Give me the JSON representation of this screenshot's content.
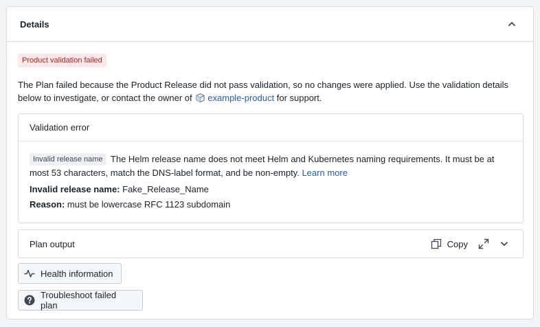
{
  "details": {
    "title": "Details",
    "badge": "Product validation failed",
    "message_before": "The Plan failed because the Product Release did not pass validation, so no changes were applied. Use the validation details below to investigate, or contact the owner of",
    "product_link": "example-product",
    "message_after": "for support."
  },
  "validation": {
    "title": "Validation error",
    "tag": "Invalid release name",
    "description": "The Helm release name does not meet Helm and Kubernetes naming requirements. It must be at most 53 characters, match the DNS-label format, and be non-empty.",
    "learn_more": "Learn more",
    "name_label": "Invalid release name:",
    "name_value": "Fake_Release_Name",
    "reason_label": "Reason:",
    "reason_value": "must be lowercase RFC 1123 subdomain"
  },
  "plan_output": {
    "title": "Plan output",
    "copy_label": "Copy"
  },
  "buttons": {
    "health": "Health information",
    "troubleshoot": "Troubleshoot failed plan"
  },
  "icons": {
    "collapse": "chevron-up-icon",
    "product": "cube-icon",
    "copy": "duplicate-icon",
    "expand": "maximize-icon",
    "expand_section": "chevron-down-icon",
    "health": "pulse-icon",
    "help": "question-circle-icon"
  },
  "colors": {
    "badge_bg": "#fbe8e8",
    "badge_text": "#b11e1e",
    "link": "#215db0"
  }
}
